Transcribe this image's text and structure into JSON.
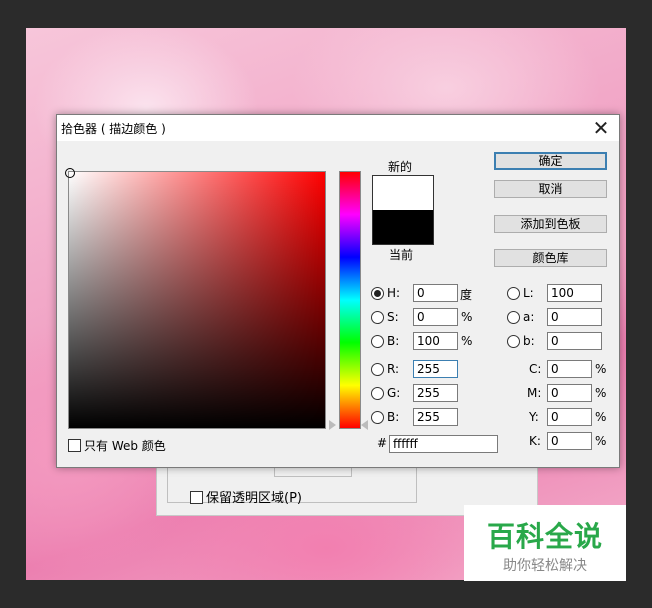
{
  "dialog": {
    "title": "拾色器 ( 描边颜色 )",
    "close_glyph": "✕"
  },
  "preview": {
    "new_label": "新的",
    "current_label": "当前",
    "new_color": "#ffffff",
    "current_color": "#000000"
  },
  "buttons": {
    "ok": "确定",
    "cancel": "取消",
    "add_to_swatches": "添加到色板",
    "color_libraries": "颜色库"
  },
  "hsb": {
    "h": {
      "label": "H:",
      "value": "0",
      "unit": "度",
      "selected": true
    },
    "s": {
      "label": "S:",
      "value": "0",
      "unit": "%"
    },
    "b": {
      "label": "B:",
      "value": "100",
      "unit": "%"
    }
  },
  "rgb": {
    "r": {
      "label": "R:",
      "value": "255"
    },
    "g": {
      "label": "G:",
      "value": "255"
    },
    "b": {
      "label": "B:",
      "value": "255"
    }
  },
  "lab": {
    "l": {
      "label": "L:",
      "value": "100"
    },
    "a": {
      "label": "a:",
      "value": "0"
    },
    "b": {
      "label": "b:",
      "value": "0"
    }
  },
  "cmyk": {
    "c": {
      "label": "C:",
      "value": "0",
      "unit": "%"
    },
    "m": {
      "label": "M:",
      "value": "0",
      "unit": "%"
    },
    "y": {
      "label": "Y:",
      "value": "0",
      "unit": "%"
    },
    "k": {
      "label": "K:",
      "value": "0",
      "unit": "%"
    }
  },
  "hex": {
    "label": "#",
    "value": "ffffff"
  },
  "web_only": {
    "label": "只有 Web 颜色",
    "checked": false
  },
  "back_dialog": {
    "preserve_transparency_label": "保留透明区域(P)"
  },
  "watermark": {
    "title": "百科全说",
    "subtitle": "助你轻松解决"
  }
}
